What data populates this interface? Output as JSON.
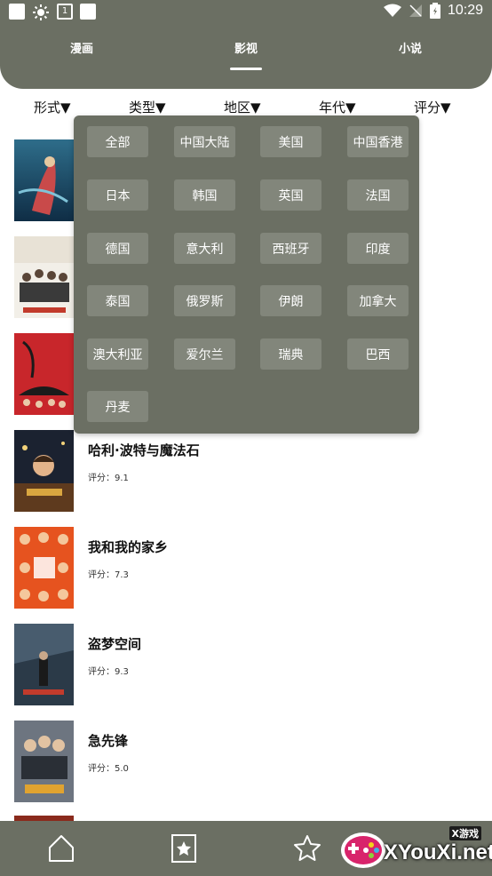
{
  "header": {
    "status": {
      "time": "10:29",
      "calendar_day": "1"
    },
    "tabs": [
      {
        "label": "漫画",
        "active": false
      },
      {
        "label": "影视",
        "active": true
      },
      {
        "label": "小说",
        "active": false
      }
    ]
  },
  "filters": [
    {
      "label": "形式▼"
    },
    {
      "label": "类型▼"
    },
    {
      "label": "地区▼"
    },
    {
      "label": "年代▼"
    },
    {
      "label": "评分▼"
    }
  ],
  "region_dropdown": {
    "options": [
      "全部",
      "中国大陆",
      "美国",
      "中国香港",
      "日本",
      "韩国",
      "英国",
      "法国",
      "德国",
      "意大利",
      "西班牙",
      "印度",
      "泰国",
      "俄罗斯",
      "伊朗",
      "加拿大",
      "澳大利亚",
      "爱尔兰",
      "瑞典",
      "巴西",
      "丹麦"
    ]
  },
  "movies": [
    {
      "title": "哈利·波特与魔法石",
      "rating": "评分：9.1"
    },
    {
      "title": "我和我的家乡",
      "rating": "评分：7.3"
    },
    {
      "title": "盗梦空间",
      "rating": "评分：9.3"
    },
    {
      "title": "急先锋",
      "rating": "评分：5.0"
    }
  ],
  "bottom_nav": [
    {
      "icon": "home-icon"
    },
    {
      "icon": "bookmark-star-icon"
    },
    {
      "icon": "star-icon"
    }
  ],
  "watermark": {
    "top_text": "X游戏",
    "main_text": "XYouXi.net"
  },
  "colors": {
    "theme": "#6b6f63",
    "option_bg": "#82867b",
    "text": "#111111"
  }
}
